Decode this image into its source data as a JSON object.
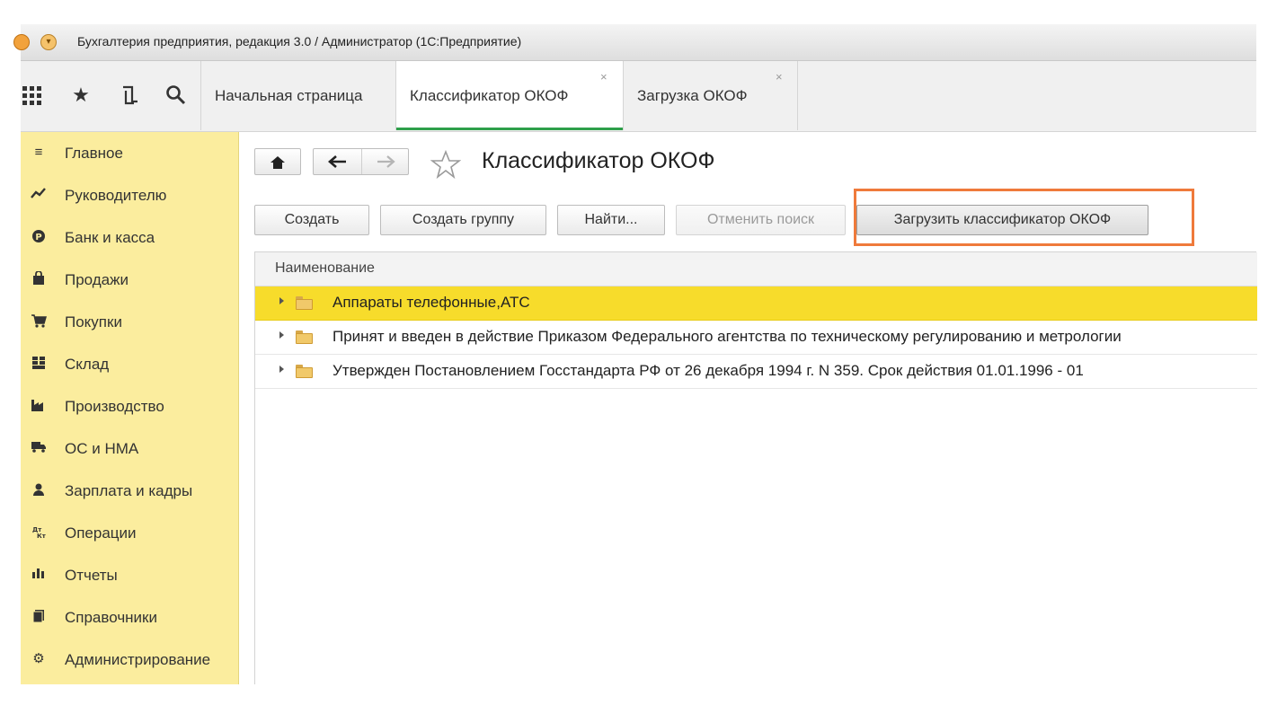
{
  "window": {
    "title": "Бухгалтерия предприятия, редакция 3.0 / Администратор  (1С:Предприятие)"
  },
  "toolbar_icons": [
    "apps-grid-icon",
    "star-icon",
    "history-icon",
    "search-icon"
  ],
  "tabs": [
    {
      "label": "Начальная страница",
      "closable": false
    },
    {
      "label": "Классификатор ОКОФ",
      "closable": true,
      "active": true,
      "close": "×"
    },
    {
      "label": "Загрузка ОКОФ",
      "closable": true,
      "close": "×"
    }
  ],
  "sidebar": {
    "items": [
      {
        "label": "Главное",
        "icon": "menu-icon"
      },
      {
        "label": "Руководителю",
        "icon": "trend-icon"
      },
      {
        "label": "Банк и касса",
        "icon": "bank-icon"
      },
      {
        "label": "Продажи",
        "icon": "bag-icon"
      },
      {
        "label": "Покупки",
        "icon": "cart-icon"
      },
      {
        "label": "Склад",
        "icon": "warehouse-icon"
      },
      {
        "label": "Производство",
        "icon": "factory-icon"
      },
      {
        "label": "ОС и НМА",
        "icon": "truck-icon"
      },
      {
        "label": "Зарплата и кадры",
        "icon": "person-icon"
      },
      {
        "label": "Операции",
        "icon": "operations-icon"
      },
      {
        "label": "Отчеты",
        "icon": "bar-chart-icon"
      },
      {
        "label": "Справочники",
        "icon": "book-icon"
      },
      {
        "label": "Администрирование",
        "icon": "gear-icon"
      }
    ]
  },
  "page": {
    "title": "Классификатор ОКОФ"
  },
  "actions": {
    "create": "Создать",
    "create_group": "Создать группу",
    "find": "Найти...",
    "cancel_search": "Отменить поиск",
    "load_classifier": "Загрузить классификатор ОКОФ"
  },
  "table": {
    "column_header": "Наименование",
    "rows": [
      {
        "text": "Аппараты телефонные,АТС",
        "selected": true
      },
      {
        "text": "Принят и введен в действие Приказом Федерального агентства по техническому регулированию и метрологии",
        "selected": false
      },
      {
        "text": "Утвержден Постановлением Госстандарта РФ от 26 декабря 1994 г. N 359.  Срок действия 01.01.1996 - 01",
        "selected": false
      }
    ]
  },
  "colors": {
    "sidebar_bg": "#fbed9e",
    "selected_row": "#f7dc2b",
    "active_tab_underline": "#2e9f4a",
    "highlight_frame": "#ef7a3b"
  }
}
